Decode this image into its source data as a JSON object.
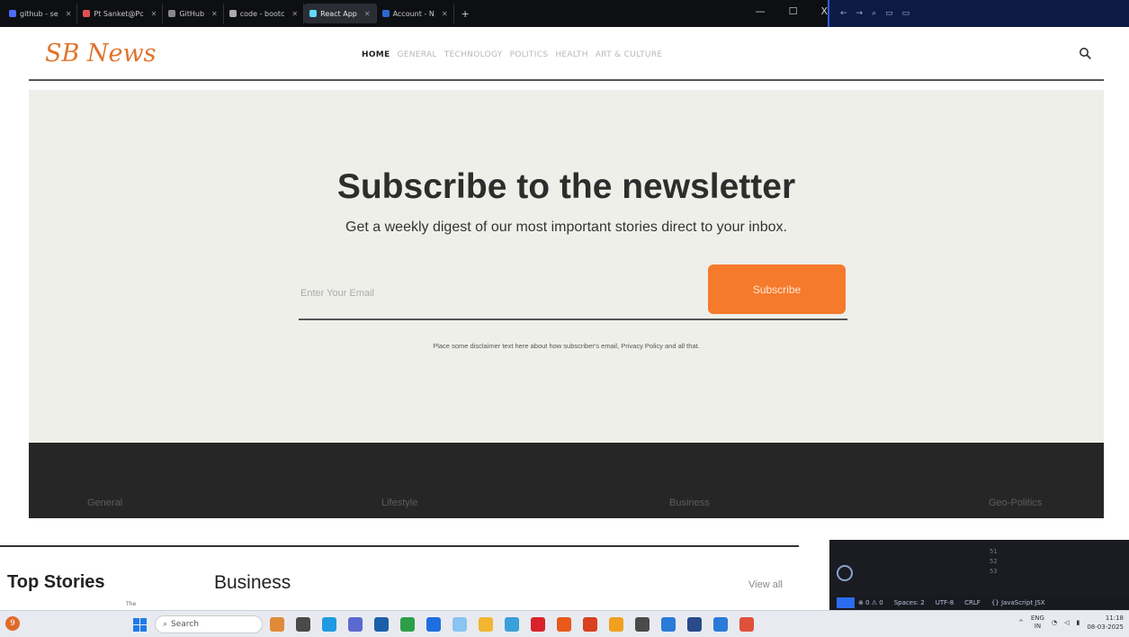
{
  "browser": {
    "tabs": [
      {
        "label": "github - se",
        "active": false
      },
      {
        "label": "Pt Sanket@Pc",
        "active": false
      },
      {
        "label": "GitHub",
        "active": false
      },
      {
        "label": "code - bootc",
        "active": false
      },
      {
        "label": "React App",
        "active": true
      },
      {
        "label": "Account - N",
        "active": false
      }
    ],
    "new_tab": "+",
    "controls": {
      "minimize": "—",
      "maximize": "☐",
      "close": "X"
    }
  },
  "nav": {
    "logo": "SB News",
    "links": [
      "HOME",
      "GENERAL",
      "TECHNOLOGY",
      "POLITICS",
      "HEALTH",
      "ART & CULTURE"
    ],
    "active_index": 0
  },
  "subscribe": {
    "title": "Subscribe to the newsletter",
    "description": "Get a weekly digest of our most important stories direct to your inbox.",
    "email_placeholder": "Enter Your Email",
    "button_label": "Subscribe",
    "disclaimer": "Place some disclaimer text here about how subscriber's email, Privacy Policy and all that."
  },
  "categories": [
    "General",
    "Lifestyle",
    "Business",
    "Geo-Politics"
  ],
  "lower": {
    "top_stories": "Top Stories",
    "tiny_text": "The",
    "section_title": "Business",
    "view_all": "View all"
  },
  "vscode": {
    "line_numbers": [
      "51",
      "52",
      "53"
    ],
    "status_items": [
      "⊗ 0 ⚠ 0",
      "Spaces: 2",
      "UTF-8",
      "CRLF",
      "{} JavaScript JSX"
    ]
  },
  "taskbar": {
    "badge": "9",
    "search_label": "Search",
    "app_colors": [
      "#e08a3a",
      "#4a4a4a",
      "#1e9ae0",
      "#5b6ad0",
      "#1c5fa8",
      "#2e9e4a",
      "#1f6ee0",
      "#8ac4f0",
      "#f2b630",
      "#3aa0d8",
      "#d8232a",
      "#e85a1a",
      "#d84020",
      "#f0a020",
      "#4a4a4a",
      "#2a7ad8",
      "#2a4a8a",
      "#2a7ad8",
      "#e0503a"
    ],
    "lang": "ENG",
    "lang_region": "IN",
    "time": "11:18",
    "date": "08-03-2025"
  },
  "colors": {
    "accent": "#f57a2c",
    "logo": "#e0742c",
    "band": "#262626",
    "subscribe_bg": "#efefea"
  }
}
